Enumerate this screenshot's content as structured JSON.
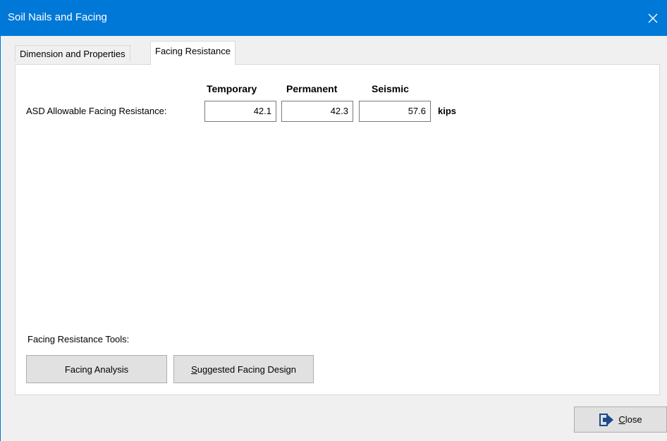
{
  "window": {
    "title": "Soil Nails and Facing"
  },
  "tabs": [
    {
      "label": "Dimension and Properties",
      "active": false
    },
    {
      "label": "Facing Resistance",
      "active": true
    }
  ],
  "facing_resistance": {
    "columns": [
      "Temporary",
      "Permanent",
      "Seismic"
    ],
    "row_label": "ASD Allowable Facing Resistance:",
    "values": {
      "temporary": "42.1",
      "permanent": "42.3",
      "seismic": "57.6"
    },
    "unit": "kips"
  },
  "tools": {
    "label": "Facing Resistance Tools:",
    "facing_analysis_label": "Facing Analysis",
    "suggested_design_label": "Suggested Facing Design"
  },
  "footer": {
    "close_label": "Close"
  },
  "colors": {
    "titlebar": "#0078d7",
    "window_bg": "#f0f0f0",
    "button_bg": "#e1e1e1",
    "close_icon": "#1c4a8c"
  },
  "icons": {
    "window_close": "close-icon",
    "close_button": "exit-door-icon"
  }
}
